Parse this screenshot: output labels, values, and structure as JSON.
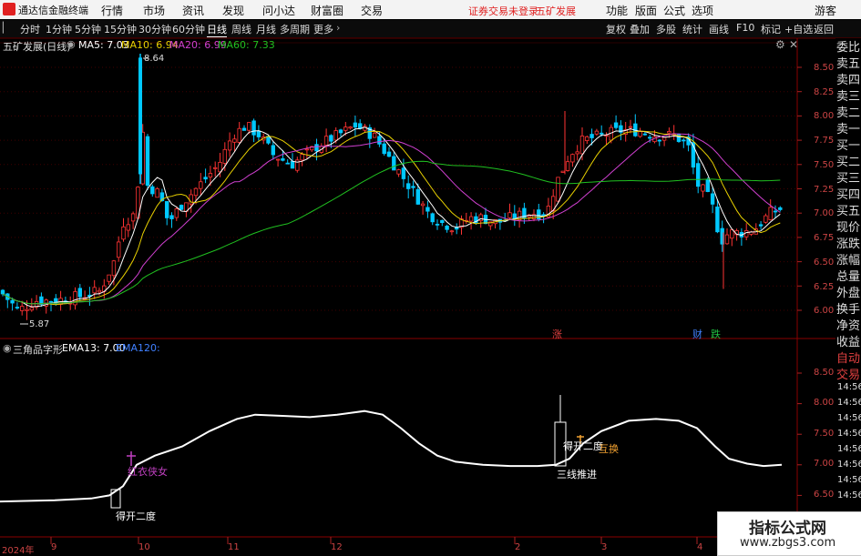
{
  "titlebar": {
    "app_name": "通达信金融终端",
    "menu": [
      "行情",
      "市场",
      "资讯",
      "发现",
      "问小达",
      "财富圈",
      "交易"
    ],
    "notice": "证券交易未登录",
    "stock_link": "五矿发展",
    "right_menu": [
      "功能",
      "版面",
      "公式",
      "选项"
    ],
    "user": "游客"
  },
  "toolbar": {
    "periods": [
      "分时",
      "1分钟",
      "5分钟",
      "15分钟",
      "30分钟",
      "60分钟",
      "日线",
      "周线",
      "月线",
      "多周期",
      "更多"
    ],
    "selected_period": "日线",
    "right_items": [
      "复权",
      "叠加",
      "多股",
      "统计",
      "画线",
      "F10",
      "标记",
      "+自选",
      "返回"
    ]
  },
  "sidebar": [
    "委比",
    "卖五",
    "卖四",
    "卖三",
    "卖二",
    "卖一",
    "买一",
    "买二",
    "买三",
    "买四",
    "买五",
    "现价",
    "涨跌",
    "涨幅",
    "总量",
    "外盘",
    "换手",
    "净资",
    "收益",
    "自动",
    "交易"
  ],
  "main_panel": {
    "stock_label": "五矿发展(日线)",
    "ma_labels": [
      {
        "text": "MA5: 7.03",
        "color": "#ffffff"
      },
      {
        "text": "MA10: 6.94",
        "color": "#e8d000"
      },
      {
        "text": "MA20: 6.99",
        "color": "#d040d0"
      },
      {
        "text": "MA60: 7.33",
        "color": "#20c020"
      }
    ],
    "price_ticks": [
      "8.50",
      "8.25",
      "8.00",
      "7.75",
      "7.50",
      "7.25",
      "7.00",
      "6.75",
      "6.50",
      "6.25",
      "6.00"
    ],
    "high_label": "8.64",
    "low_label": "5.87",
    "markers": [
      {
        "text": "涨",
        "color": "#e04040"
      },
      {
        "text": "财",
        "color": "#4080ff"
      },
      {
        "text": "跌",
        "color": "#20c040"
      }
    ]
  },
  "sub_panel": {
    "indicator_label": "三角品字形",
    "ema13_label": "EMA13: 7.00",
    "ema120_label": "EMA120:",
    "value_ticks": [
      "8.50",
      "8.00",
      "7.50",
      "7.00",
      "6.50"
    ],
    "signals": {
      "first": "得开二度",
      "cross": "红衣侠女",
      "advance": "三线推进",
      "second": "得开二度",
      "swap": "互换"
    }
  },
  "time_axis": {
    "year": "2024年",
    "months": [
      "9",
      "10",
      "11",
      "12",
      "2",
      "3",
      "4"
    ]
  },
  "right_times": [
    "14:56",
    "14:56",
    "14:56",
    "14:56",
    "14:56",
    "14:56",
    "14:56",
    "14:56",
    "14:56",
    "14:56"
  ],
  "watermark": {
    "title": "指标公式网",
    "url": "www.zbgs3.com"
  },
  "colors": {
    "up": "#ff3333",
    "down": "#00c8ff",
    "ma5": "#ffffff",
    "ma10": "#e8d000",
    "ma20": "#d040d0",
    "ma60": "#20c020"
  }
}
